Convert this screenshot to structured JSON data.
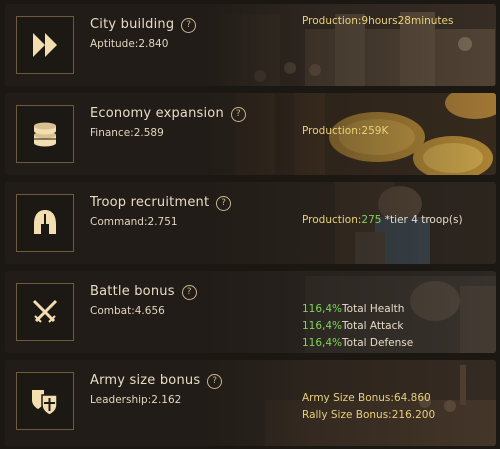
{
  "cards": [
    {
      "title": "City building",
      "stat_label": "Aptitude",
      "stat_value": "2.840",
      "production_label": "Production:",
      "production_value": "9hours28minutes",
      "icon": "double-arrow-icon"
    },
    {
      "title": "Economy expansion",
      "stat_label": "Finance",
      "stat_value": "2.589",
      "production_label": "Production:",
      "production_value": "259K",
      "icon": "coin-stack-icon"
    },
    {
      "title": "Troop recruitment",
      "stat_label": "Command",
      "stat_value": "2.751",
      "production_label": "Production:",
      "production_value": "275",
      "production_suffix": " *tier 4 troop(s)",
      "icon": "helmet-icon"
    },
    {
      "title": "Battle bonus",
      "stat_label": "Combat",
      "stat_value": "4.656",
      "bonuses": [
        {
          "value": "116,4%",
          "label": "Total Health"
        },
        {
          "value": "116,4%",
          "label": "Total Attack"
        },
        {
          "value": "116,4%",
          "label": "Total Defense"
        }
      ],
      "icon": "crossed-swords-icon"
    },
    {
      "title": "Army size bonus",
      "stat_label": "Leadership",
      "stat_value": "2.162",
      "army_label": "Army Size Bonus:",
      "army_value": "64.860",
      "rally_label": "Rally Size Bonus:",
      "rally_value": "216.200",
      "icon": "shields-icon"
    }
  ],
  "help_symbol": "?",
  "colors": {
    "gold": "#ead07a",
    "green": "#7fd35a",
    "frame": "#6d5b3e"
  }
}
